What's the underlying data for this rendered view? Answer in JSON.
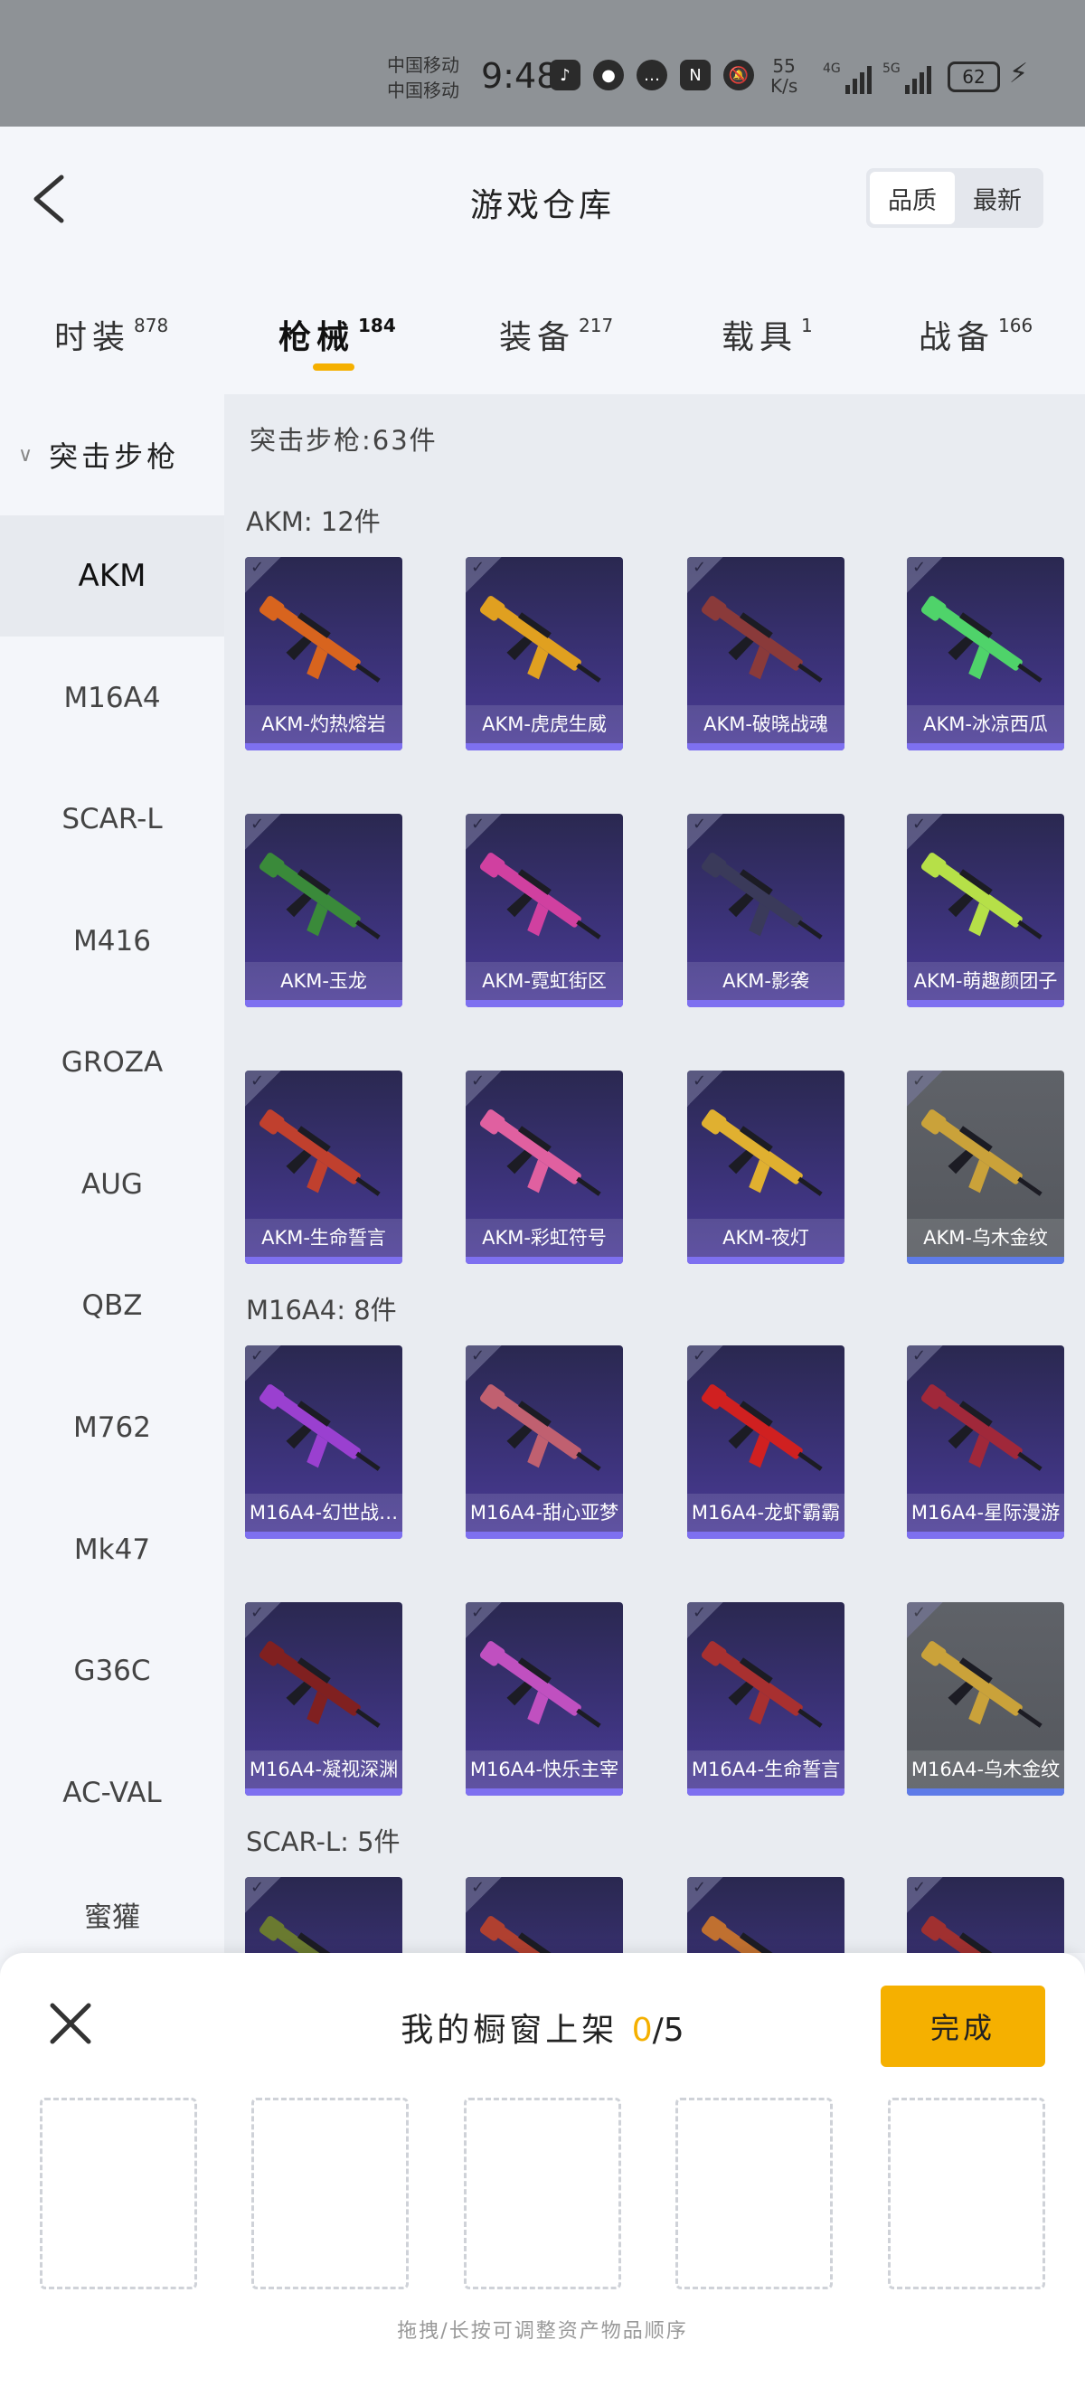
{
  "status_bar": {
    "carrier_1": "中国移动",
    "carrier_2": "中国移动",
    "time": "9:48",
    "net_speed_value": "55",
    "net_speed_unit": "K/s",
    "signal_1_label": "4G",
    "signal_2_label": "5G",
    "battery": "62",
    "icons": [
      "tiktok-icon",
      "wechat-icon",
      "message-icon",
      "nfc-icon",
      "mute-bell-icon",
      "charging-icon"
    ]
  },
  "header": {
    "title": "游戏仓库",
    "sort_quality": "品质",
    "sort_newest": "最新"
  },
  "tabs": [
    {
      "label": "时装",
      "count": "878"
    },
    {
      "label": "枪械",
      "count": "184"
    },
    {
      "label": "装备",
      "count": "217"
    },
    {
      "label": "载具",
      "count": "1"
    },
    {
      "label": "战备",
      "count": "166"
    }
  ],
  "sidebar": {
    "header": "突击步枪",
    "items": [
      "AKM",
      "M16A4",
      "SCAR-L",
      "M416",
      "GROZA",
      "AUG",
      "QBZ",
      "M762",
      "Mk47",
      "G36C",
      "AC-VAL",
      "蜜獾"
    ]
  },
  "content": {
    "category_title": "突击步枪:63件",
    "groups": [
      {
        "title": "AKM: 12件",
        "items": [
          "AKM-灼热熔岩",
          "AKM-虎虎生威",
          "AKM-破晓战魂",
          "AKM-冰凉西瓜",
          "AKM-玉龙",
          "AKM-霓虹街区",
          "AKM-影袭",
          "AKM-萌趣颜团子",
          "AKM-生命誓言",
          "AKM-彩虹符号",
          "AKM-夜灯",
          "AKM-乌木金纹"
        ]
      },
      {
        "title": "M16A4: 8件",
        "items": [
          "M16A4-幻世战…",
          "M16A4-甜心亚梦",
          "M16A4-龙虾霸霸",
          "M16A4-星际漫游",
          "M16A4-凝视深渊",
          "M16A4-快乐主宰",
          "M16A4-生命誓言",
          "M16A4-乌木金纹"
        ]
      },
      {
        "title": "SCAR-L: 5件",
        "items": []
      }
    ]
  },
  "gun_colors": [
    "#d8641e",
    "#e0a020",
    "#8a3a3a",
    "#4fd36a",
    "#3a8a3a",
    "#d040a0",
    "#3a3a5a",
    "#b6e048",
    "#c0402e",
    "#e060a0",
    "#e0b030",
    "#caa23a",
    "#9a40d0",
    "#c06070",
    "#d02020",
    "#a0283a",
    "#802020",
    "#c050c0",
    "#a83030",
    "#caa23a",
    "#6a7a30",
    "#b04030",
    "#c07030",
    "#a03030"
  ],
  "bottom_panel": {
    "title": "我的橱窗上架",
    "count_current": "0",
    "separator": "/",
    "count_total": "5",
    "done_label": "完成",
    "hint": "拖拽/长按可调整资产物品顺序"
  }
}
